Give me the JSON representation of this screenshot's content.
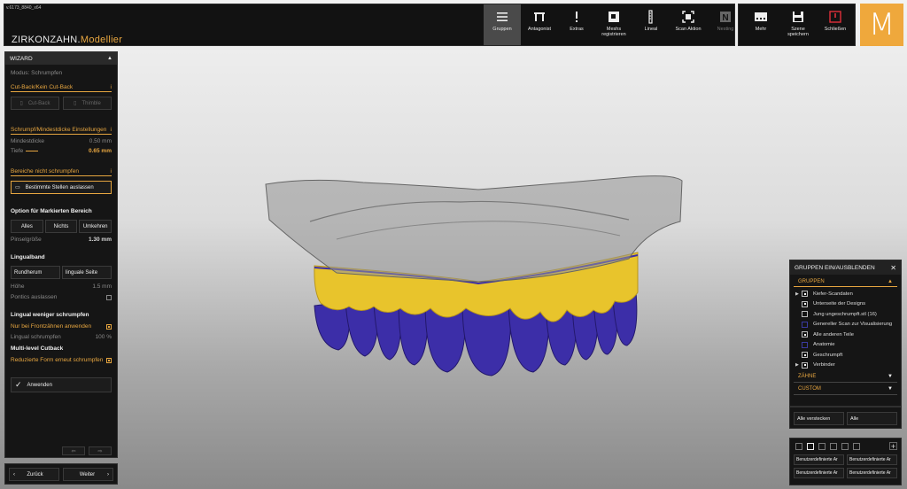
{
  "app": {
    "version": "v.6173_8840_x64",
    "brand_main": "ZIRKONZAHN.",
    "brand_accent": "Modellier",
    "logo_letter": "M"
  },
  "toolbar": [
    {
      "id": "gruppen",
      "label": "Gruppen",
      "icon": "menu-icon",
      "active": true
    },
    {
      "id": "antagonist",
      "label": "Antagonist",
      "icon": "antagonist-icon"
    },
    {
      "id": "extras",
      "label": "Extras",
      "icon": "exclamation-icon"
    },
    {
      "id": "meshs",
      "label": "Meshs\nregistrieren",
      "icon": "mesh-icon"
    },
    {
      "id": "lineal",
      "label": "Lineal",
      "icon": "ruler-icon"
    },
    {
      "id": "scan",
      "label": "Scan Aktion",
      "icon": "scan-icon"
    },
    {
      "id": "nesting",
      "label": "Nesting",
      "icon": "nesting-icon",
      "disabled": true
    }
  ],
  "right_toolbar": [
    {
      "id": "mehr",
      "label": "Mehr",
      "icon": "more-icon"
    },
    {
      "id": "save",
      "label": "Szene\nspeichern",
      "icon": "save-icon"
    },
    {
      "id": "close",
      "label": "Schließen",
      "icon": "power-icon"
    }
  ],
  "wizard": {
    "title": "WIZARD",
    "mode": "Modus: Schrumpfen",
    "cutback_section": "Cut-Back/Kein Cut-Back",
    "cutback_btn": "Cut-Back",
    "thimble_btn": "Thimble",
    "shrink_section": "Schrumpf/Mindestdicke Einstellungen",
    "min_label": "Mindestdicke",
    "min_value": "0.50 mm",
    "depth_label": "Tiefe",
    "depth_value": "0.65 mm",
    "noshrink_section": "Bereiche nicht schrumpfen",
    "exclude_btn": "Bestimmte Stellen auslassen",
    "option_title": "Option für Markierten Bereich",
    "opt_all": "Alles",
    "opt_none": "Nichts",
    "opt_invert": "Umkehren",
    "brush_label": "Pinselgröße",
    "brush_value": "1.30 mm",
    "lingual_title": "Lingualband",
    "round_btn": "Rundherum",
    "lingual_side_btn": "linguale Seite",
    "height_label": "Höhe",
    "height_value": "1.5 mm",
    "pontics_label": "Pontics auslassen",
    "lingual_less_title": "Lingual weniger schrumpfen",
    "front_only_label": "Nur bei Frontzähnen anwenden",
    "lingual_shrink_label": "Lingual schrumpfen",
    "lingual_shrink_value": "100 %",
    "multilevel_title": "Multi-level Cutback",
    "reduce_label": "Reduzierte Form erneut schrumpfen",
    "apply_btn": "Anwenden"
  },
  "nav": {
    "back": "Zurück",
    "next": "Weiter"
  },
  "groups_panel": {
    "title": "GRUPPEN EIN/AUSBLENDEN",
    "groups_label": "GRUPPEN",
    "items": [
      {
        "label": "Kiefer-Scandaten",
        "expand": true,
        "checked": true
      },
      {
        "label": "Unterseite der Designs",
        "expand": false,
        "checked": true
      },
      {
        "label": "Jung ungeschrumpft.stl (16)",
        "expand": false,
        "checked": false
      },
      {
        "label": "Genereller Scan zur Visualisierung",
        "expand": false,
        "checked": false,
        "blue": true
      },
      {
        "label": "Alle anderen Teile",
        "expand": false,
        "checked": true
      },
      {
        "label": "Anatomie",
        "expand": false,
        "checked": false,
        "blue": true
      },
      {
        "label": "Geschrumpft",
        "expand": false,
        "checked": true
      },
      {
        "label": "Verbinder",
        "expand": true,
        "checked": true
      }
    ],
    "teeth_label": "ZÄHNE",
    "custom_label": "CUSTOM",
    "hide_btn": "Alle verstecken",
    "all_btn": "Alle",
    "custom_buttons": [
      "Benutzerdefinierte Ar",
      "Benutzerdefinierte Ar",
      "Benutzerdefinierte Ar",
      "Benutzerdefinierte Ar"
    ]
  },
  "colors": {
    "accent": "#e7a640",
    "teeth": "#3c2ea8",
    "crown": "#e8c42c"
  }
}
